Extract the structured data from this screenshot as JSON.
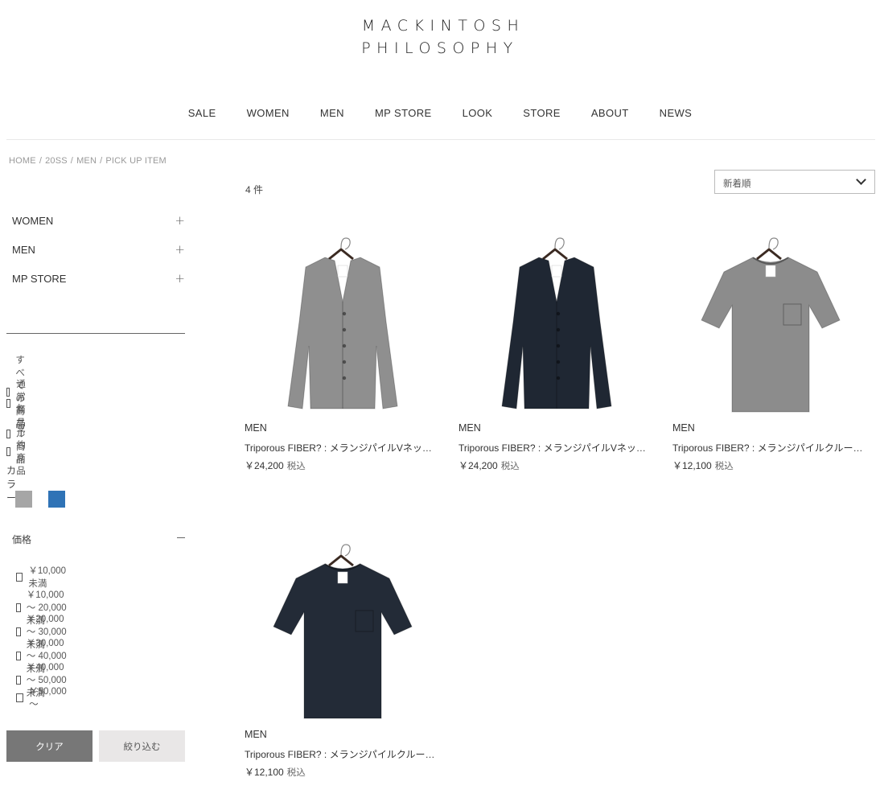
{
  "brand": {
    "line1": "MACKINTOSH",
    "line2": "PHILOSOPHY"
  },
  "nav": [
    "SALE",
    "WOMEN",
    "MEN",
    "MP STORE",
    "LOOK",
    "STORE",
    "ABOUT",
    "NEWS"
  ],
  "breadcrumb": [
    "HOME",
    "20SS",
    "MEN",
    "PICK UP ITEM"
  ],
  "sidebar": {
    "categories": [
      "WOMEN",
      "MEN",
      "MP STORE"
    ],
    "type_filters": [
      "すべての商品",
      "通常商品",
      "セール商品",
      "予約商品"
    ],
    "color_label": "カラー",
    "colors": [
      "#a6a6a6",
      "#2f73b6"
    ],
    "price_label": "価格",
    "price_filters": [
      "￥10,000未満",
      "￥10,000 ～ 20,000未満",
      "￥20,000 ～ 30,000未満",
      "￥30,000 ～ 40,000未満",
      "￥40,000 ～ 50,000未満",
      "￥50,000 ～"
    ],
    "clear_label": "クリア",
    "filter_label": "絞り込む"
  },
  "results": {
    "count": "4 件",
    "sort_value": "新着順"
  },
  "products": [
    {
      "category": "MEN",
      "name": "Triporous FIBER? : メランジパイルVネックカーディガン",
      "price": "￥24,200",
      "tax": "税込",
      "garment": "cardigan",
      "color": "#8f8f8f"
    },
    {
      "category": "MEN",
      "name": "Triporous FIBER? : メランジパイルVネックカーディガン",
      "price": "￥24,200",
      "tax": "税込",
      "garment": "cardigan",
      "color": "#1f2733"
    },
    {
      "category": "MEN",
      "name": "Triporous FIBER? : メランジパイルクルーネックTシャツ",
      "price": "￥12,100",
      "tax": "税込",
      "garment": "tshirt",
      "color": "#8c8c8c"
    },
    {
      "category": "MEN",
      "name": "Triporous FIBER? : メランジパイルクルーネックTシャツ",
      "price": "￥12,100",
      "tax": "税込",
      "garment": "tshirt",
      "color": "#232b37"
    }
  ]
}
